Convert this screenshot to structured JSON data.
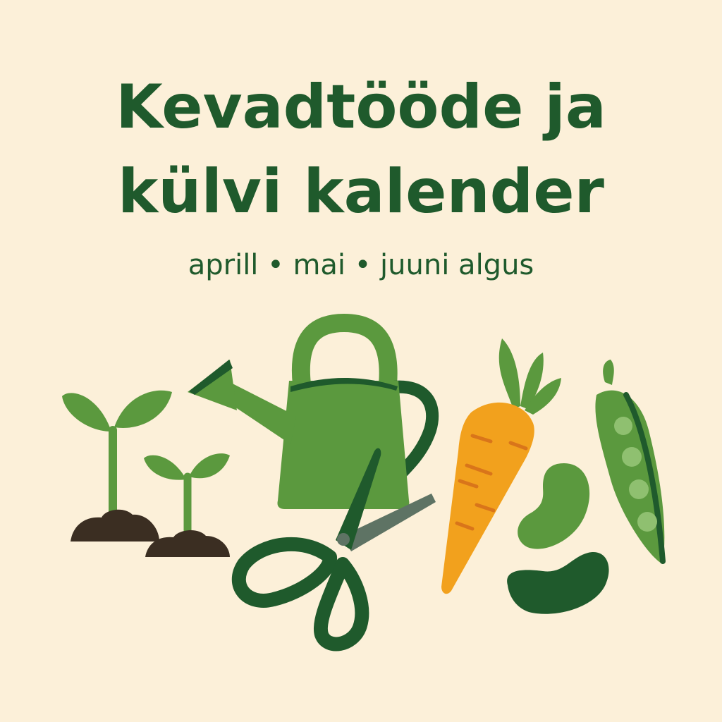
{
  "poster": {
    "title_line1": "Kevadtööde ja",
    "title_line2": "külvi kalender",
    "subtitle": "aprill • mai • juuni algus"
  },
  "colors": {
    "background": "#fcf0d9",
    "text_green": "#1f5a2c",
    "leaf_green": "#5b993e",
    "dark_green": "#1f5a2c",
    "soil": "#3b2e22",
    "carrot": "#f2a11d",
    "blade_grey": "#5e7364"
  },
  "illustrations": [
    {
      "id": "seedling-large",
      "icon": "seedling-icon"
    },
    {
      "id": "seedling-small",
      "icon": "seedling-icon"
    },
    {
      "id": "watering-can",
      "icon": "watering-can-icon"
    },
    {
      "id": "scissors",
      "icon": "scissors-icon"
    },
    {
      "id": "carrot",
      "icon": "carrot-icon"
    },
    {
      "id": "bean-light",
      "icon": "bean-icon"
    },
    {
      "id": "bean-dark",
      "icon": "bean-icon"
    },
    {
      "id": "pea-pod",
      "icon": "pea-pod-icon"
    }
  ]
}
